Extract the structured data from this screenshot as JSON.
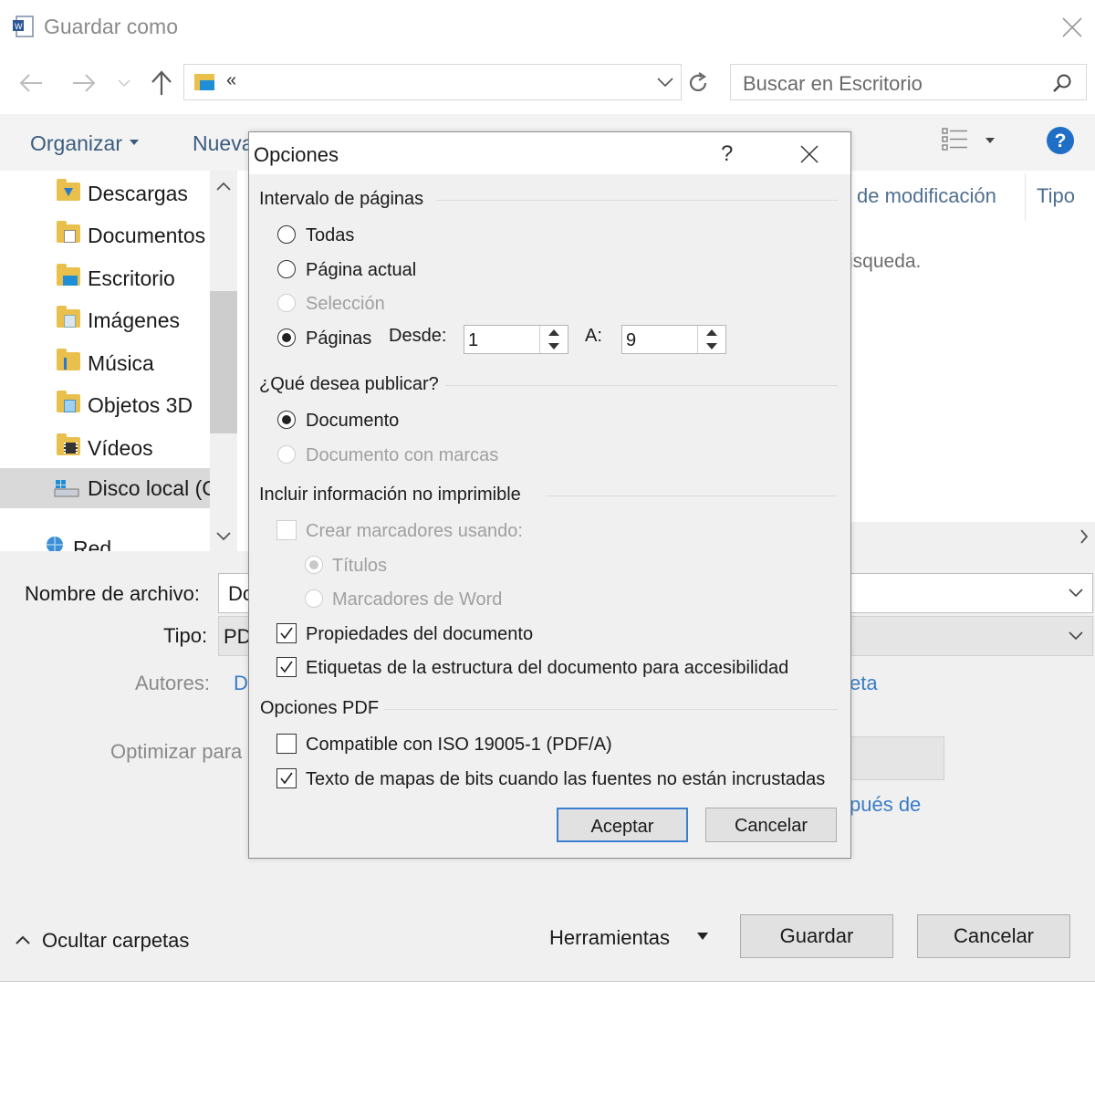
{
  "window": {
    "title": "Guardar como",
    "address_text": "«",
    "search_placeholder": "Buscar en Escritorio"
  },
  "toolbar": {
    "organize": "Organizar",
    "new_folder_partial": "Nueva"
  },
  "file_list": {
    "col_modified": "de modificación",
    "col_type": "Tipo",
    "empty_message_partial": "isqueda."
  },
  "sidebar": {
    "items": [
      {
        "label": "Descargas",
        "icon": "downloads-folder-icon"
      },
      {
        "label": "Documentos",
        "icon": "documents-folder-icon"
      },
      {
        "label": "Escritorio",
        "icon": "desktop-folder-icon"
      },
      {
        "label": "Imágenes",
        "icon": "pictures-folder-icon"
      },
      {
        "label": "Música",
        "icon": "music-folder-icon"
      },
      {
        "label": "Objetos 3D",
        "icon": "3d-objects-folder-icon"
      },
      {
        "label": "Vídeos",
        "icon": "videos-folder-icon"
      },
      {
        "label": "Disco local (C",
        "icon": "local-disk-icon"
      },
      {
        "label": "Red",
        "icon": "network-icon"
      }
    ]
  },
  "form": {
    "filename_label": "Nombre de archivo:",
    "filename_value": "Dc",
    "type_label": "Tipo:",
    "type_value": "PD",
    "authors_label": "Autores:",
    "authors_value": "D",
    "tags_partial": "eta",
    "optimize_label": "Optimizar para",
    "after_partial": "pués de"
  },
  "footer": {
    "hide_folders": "Ocultar carpetas",
    "tools": "Herramientas",
    "save": "Guardar",
    "cancel": "Cancelar"
  },
  "dialog": {
    "title": "Opciones",
    "help": "?",
    "page_range": {
      "heading": "Intervalo de páginas",
      "all": "Todas",
      "current": "Página actual",
      "selection": "Selección",
      "pages": "Páginas",
      "from_label": "Desde:",
      "from_value": "1",
      "to_label": "A:",
      "to_value": "9"
    },
    "publish": {
      "heading": "¿Qué desea publicar?",
      "document": "Documento",
      "document_markup": "Documento con marcas"
    },
    "nonprint": {
      "heading": "Incluir información no imprimible",
      "create_bookmarks": "Crear marcadores usando:",
      "headings": "Títulos",
      "word_bookmarks": "Marcadores de Word",
      "doc_properties": "Propiedades del documento",
      "structure_tags": "Etiquetas de la estructura del documento para accesibilidad"
    },
    "pdf": {
      "heading": "Opciones PDF",
      "iso": "Compatible con ISO 19005-1 (PDF/A)",
      "bitmap": "Texto de mapas de bits cuando las fuentes no están incrustadas"
    },
    "ok": "Aceptar",
    "cancel": "Cancelar"
  }
}
